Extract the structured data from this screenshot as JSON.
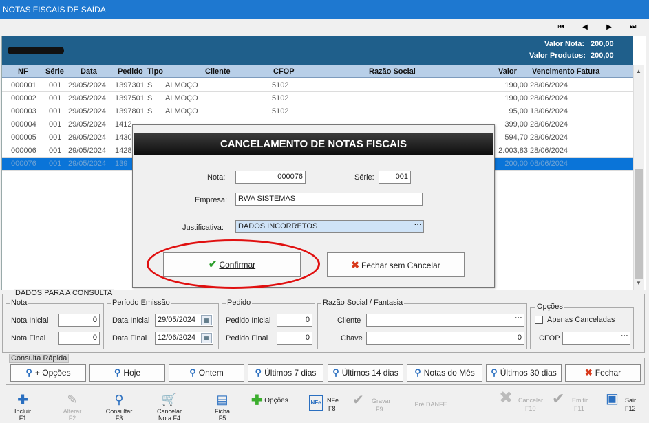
{
  "window": {
    "title": "NOTAS FISCAIS DE SAÍDA"
  },
  "nav": {
    "first": "⏮",
    "prev": "◀",
    "next": "▶",
    "last": "⏭"
  },
  "summary": {
    "valor_nota_label": "Valor Nota:",
    "valor_nota": "200,00",
    "valor_produtos_label": "Valor Produtos:",
    "valor_produtos": "200,00"
  },
  "grid": {
    "headers": {
      "nf": "NF",
      "serie": "Série",
      "data": "Data",
      "pedido": "Pedido",
      "tipo": "Tipo",
      "cliente": "Cliente",
      "cfop": "CFOP",
      "razao": "Razão Social",
      "valor": "Valor",
      "vencimento": "Vencimento Fatura"
    },
    "rows": [
      {
        "nf": "000001",
        "serie": "001",
        "data": "29/05/2024",
        "pedido": "1397301",
        "tipo": "S",
        "cliente": "ALMOÇO",
        "cfop": "5102",
        "valor": "190,00",
        "venc": "28/06/2024"
      },
      {
        "nf": "000002",
        "serie": "001",
        "data": "29/05/2024",
        "pedido": "1397501",
        "tipo": "S",
        "cliente": "ALMOÇO",
        "cfop": "5102",
        "valor": "190,00",
        "venc": "28/06/2024"
      },
      {
        "nf": "000003",
        "serie": "001",
        "data": "29/05/2024",
        "pedido": "1397801",
        "tipo": "S",
        "cliente": "ALMOÇO",
        "cfop": "5102",
        "valor": "95,00",
        "venc": "13/06/2024"
      },
      {
        "nf": "000004",
        "serie": "001",
        "data": "29/05/2024",
        "pedido": "1412",
        "tipo": "",
        "cliente": "",
        "cfop": "",
        "valor": "399,00",
        "venc": "28/06/2024"
      },
      {
        "nf": "000005",
        "serie": "001",
        "data": "29/05/2024",
        "pedido": "1430",
        "tipo": "",
        "cliente": "",
        "cfop": "",
        "valor": "594,70",
        "venc": "28/06/2024"
      },
      {
        "nf": "000006",
        "serie": "001",
        "data": "29/05/2024",
        "pedido": "1428",
        "tipo": "",
        "cliente": "",
        "cfop": "",
        "valor": "2.003,83",
        "venc": "28/06/2024"
      },
      {
        "nf": "000076",
        "serie": "001",
        "data": "29/05/2024",
        "pedido": "139",
        "tipo": "",
        "cliente": "",
        "cfop": "",
        "valor": "200,00",
        "venc": "08/06/2024"
      }
    ]
  },
  "consulta": {
    "title": "DADOS PARA A CONSULTA",
    "nota": {
      "legend": "Nota",
      "inicial_label": "Nota Inicial",
      "inicial": "0",
      "final_label": "Nota Final",
      "final": "0"
    },
    "periodo": {
      "legend": "Período Emissão",
      "inicial_label": "Data Inicial",
      "inicial": "29/05/2024",
      "final_label": "Data Final",
      "final": "12/06/2024"
    },
    "pedido": {
      "legend": "Pedido",
      "inicial_label": "Pedido Inicial",
      "inicial": "0",
      "final_label": "Pedido Final",
      "final": "0"
    },
    "razao": {
      "legend": "Razão Social / Fantasia",
      "cliente_label": "Cliente",
      "cliente": "",
      "chave_label": "Chave",
      "chave": "0"
    },
    "opcoes": {
      "legend": "Opções",
      "canceladas_label": "Apenas Canceladas",
      "cfop_label": "CFOP",
      "cfop": ""
    }
  },
  "rapida": {
    "legend": "Consulta Rápida",
    "buttons": {
      "opcoes": "+ Opções",
      "hoje": "Hoje",
      "ontem": "Ontem",
      "d7": "Últimos 7 dias",
      "d14": "Últimos 14 dias",
      "mes": "Notas do Mês",
      "d30": "Últimos 30 dias",
      "fechar": "Fechar"
    }
  },
  "toolbar": {
    "incluir": "Incluir",
    "incluir_k": "F1",
    "alterar": "Alterar",
    "alterar_k": "F2",
    "consultar": "Consultar",
    "consultar_k": "F3",
    "cancelar_nota": "Cancelar",
    "cancelar_nota_k": "Nota F4",
    "ficha": "Ficha",
    "ficha_k": "F5",
    "opcoes": "Opções",
    "nfe": "NFe",
    "nfe_k": "F8",
    "gravar": "Gravar",
    "gravar_k": "F9",
    "pre_danfe": "Pré DANFE",
    "cancelar": "Cancelar",
    "cancelar_k": "F10",
    "emitir": "Emitir",
    "emitir_k": "F11",
    "sair": "Sair",
    "sair_k": "F12",
    "nfe_icon_text": "NFe"
  },
  "dialog": {
    "title": "CANCELAMENTO DE NOTAS FISCAIS",
    "nota_label": "Nota:",
    "nota": "000076",
    "serie_label": "Série:",
    "serie": "001",
    "empresa_label": "Empresa:",
    "empresa": "RWA SISTEMAS",
    "justificativa_label": "Justificativa:",
    "justificativa": "DADOS INCORRETOS",
    "confirmar": "Confirmar",
    "fechar_sem_cancelar": "Fechar sem Cancelar"
  },
  "colors": {
    "title_bar": "#1e78d0",
    "info_bar": "#1f5f8b",
    "grid_header": "#b8cfe8",
    "selected_row": "#0a74d8",
    "annotation": "#e01010"
  }
}
